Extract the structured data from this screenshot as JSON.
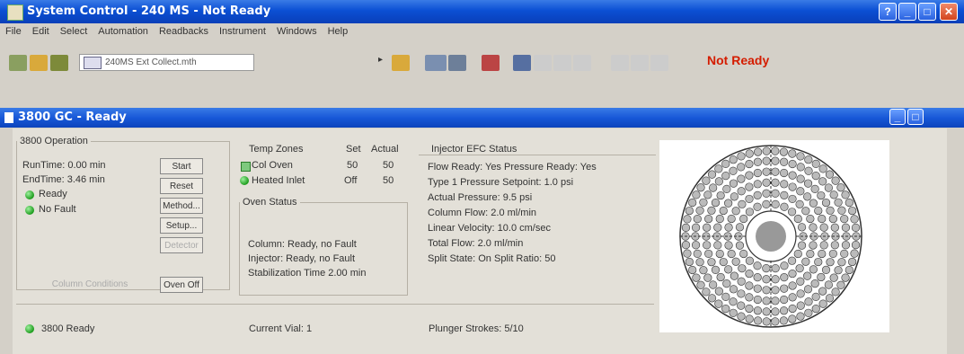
{
  "window": {
    "title": "System Control - 240 MS - Not Ready",
    "status": "Not Ready"
  },
  "menu": [
    "File",
    "Edit",
    "Select",
    "Automation",
    "Readbacks",
    "Instrument",
    "Windows",
    "Help"
  ],
  "toolbar": {
    "method_file": "240MS Ext Collect.mth"
  },
  "instrument": {
    "title": "3800 GC - Ready"
  },
  "operation": {
    "legend": "3800 Operation",
    "run_time": "RunTime: 0.00 min",
    "end_time": "EndTime: 3.46 min",
    "ready": "Ready",
    "fault": "No Fault",
    "buttons": {
      "start": "Start",
      "reset": "Reset",
      "method": "Method...",
      "setup": "Setup...",
      "disabled1": "Column Conditions",
      "disabled2": "Detector",
      "oven_off": "Oven Off"
    }
  },
  "temps": {
    "header": [
      "Temp Zones",
      "Set",
      "Actual"
    ],
    "rows": [
      {
        "name": "Col Oven",
        "set": "50",
        "actual": "50"
      },
      {
        "name": "Heated Inlet",
        "set": "Off",
        "actual": "50"
      }
    ]
  },
  "oven_status": {
    "legend": "Oven Status",
    "column": "Column: Ready, no Fault",
    "injector": "Injector: Ready, no Fault",
    "stabilization": "Stabilization Time 2.00 min"
  },
  "injector": {
    "legend": "Injector EFC Status",
    "lines": [
      "Flow Ready: Yes  Pressure Ready: Yes",
      "Type 1 Pressure Setpoint: 1.0 psi",
      "Actual Pressure: 9.5 psi",
      "Column Flow: 2.0 ml/min",
      "Linear Velocity: 10.0 cm/sec",
      "Total Flow: 2.0 ml/min",
      "Split State: On   Split Ratio: 50"
    ]
  },
  "footer": {
    "status": "3800 Ready",
    "vial": "Current Vial: 1",
    "plunger": "Plunger Strokes: 5/10"
  }
}
